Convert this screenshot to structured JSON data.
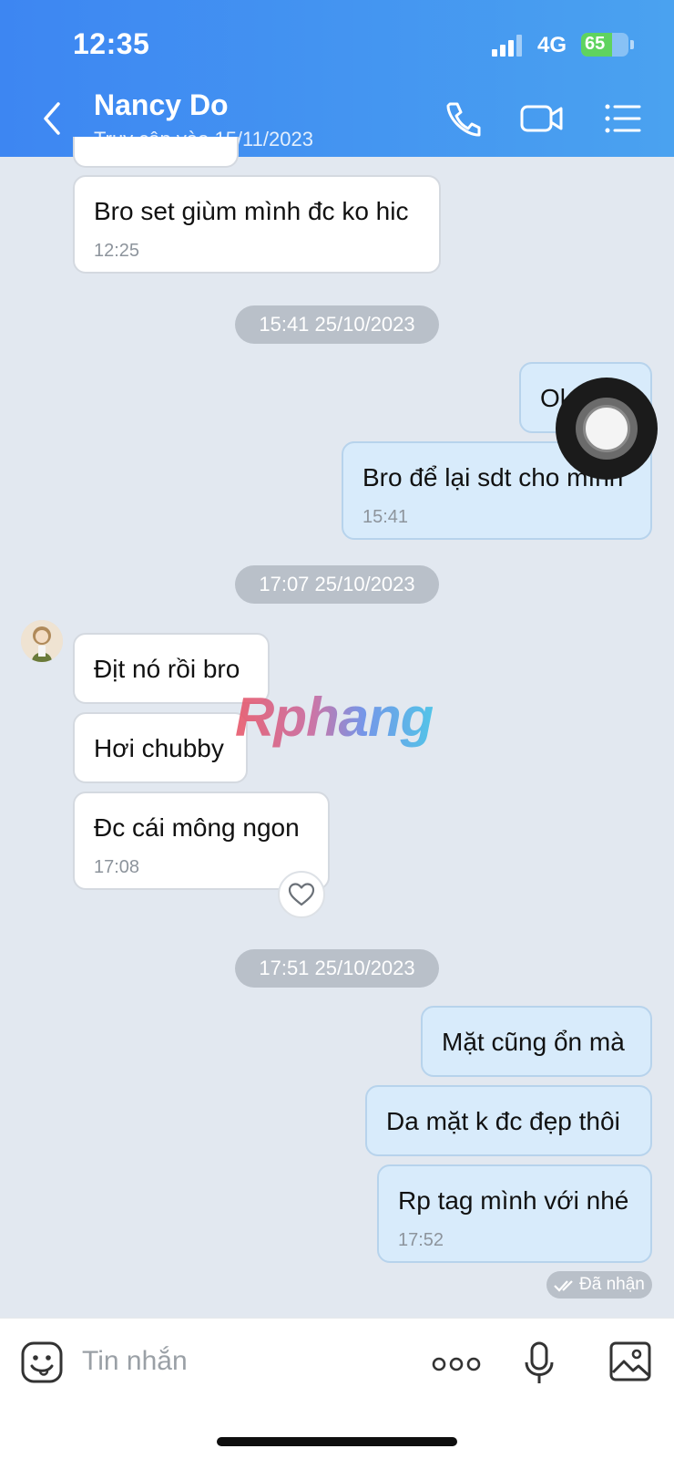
{
  "status_bar": {
    "time": "12:35",
    "network": "4G",
    "battery": "65",
    "battery_level": 0.65
  },
  "header": {
    "contact_name": "Nancy Do",
    "contact_status": "Truy cập vào 15/11/2023"
  },
  "messages": {
    "m1": {
      "text": "Bro set giùm mình đc ko hic",
      "time": "12:25"
    },
    "d1": "15:41 25/10/2023",
    "m2": {
      "text": "Ok"
    },
    "m3": {
      "text": "Bro để lại sdt cho mình",
      "time": "15:41"
    },
    "d2": "17:07 25/10/2023",
    "m4": {
      "text": "Địt nó rồi bro"
    },
    "m5": {
      "text": "Hơi chubby"
    },
    "m6": {
      "text": "Đc cái mông ngon",
      "time": "17:08"
    },
    "d3": "17:51 25/10/2023",
    "m7": {
      "text": "Mặt cũng ổn mà"
    },
    "m8": {
      "text": "Da mặt k đc đẹp thôi"
    },
    "m9": {
      "text": "Rp tag mình với nhé",
      "time": "17:52"
    }
  },
  "delivery_status": "Đã nhận",
  "watermark": "Rphang",
  "composer": {
    "placeholder": "Tin nhắn"
  },
  "colors": {
    "header_start": "#3d86f2",
    "header_end": "#4aa2f0",
    "chat_bg": "#e2e8f0",
    "own_bubble": "#d8ebfb",
    "other_bubble": "#ffffff"
  }
}
